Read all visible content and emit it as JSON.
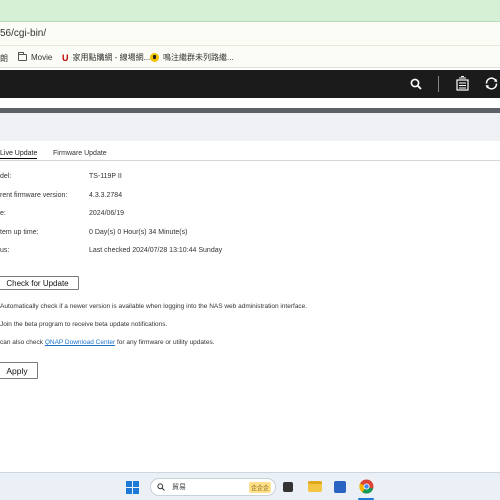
{
  "browser": {
    "url": "56/cgi-bin/",
    "bookmarks": [
      {
        "label": "朗",
        "icon": "none"
      },
      {
        "label": "Movie",
        "icon": "folder-icon"
      },
      {
        "label": "家用點購網 - 線場網...",
        "icon": "u-icon"
      },
      {
        "label": "鳴注繼群未列路繼...",
        "icon": "yellow-circle-icon"
      }
    ]
  },
  "qnap": {
    "header_icons": [
      "search-icon",
      "task-stack-icon",
      "refresh-icon"
    ]
  },
  "tabs": [
    {
      "label": "Live Update",
      "active": true
    },
    {
      "label": "Firmware Update",
      "active": false
    }
  ],
  "info": [
    {
      "label": "del:",
      "value": "TS-119P II"
    },
    {
      "label": "rent firmware version:",
      "value": "4.3.3.2784"
    },
    {
      "label": "e:",
      "value": "2024/06/19"
    },
    {
      "label": "tem up time:",
      "value": "0 Day(s) 0 Hour(s) 34 Minute(s)"
    },
    {
      "label": "us:",
      "value": "Last checked 2024/07/28 13:10:44 Sunday"
    }
  ],
  "check_button": "Check for Update",
  "options": {
    "auto_check": "Automatically check if a newer version is available when logging into the NAS web administration interface.",
    "beta": "Join the beta program to receive beta update notifications.",
    "also_check_prefix": "can also check ",
    "also_check_link": "QNAP Download Center",
    "also_check_suffix": " for any firmware or utility updates."
  },
  "apply_button": "Apply",
  "taskbar": {
    "search_text": "貿易",
    "search_badge": "企企企"
  },
  "colors": {
    "header_bg": "#1b1b1b",
    "link": "#1a73c9",
    "taskbar_bg": "#eaf0f6"
  }
}
